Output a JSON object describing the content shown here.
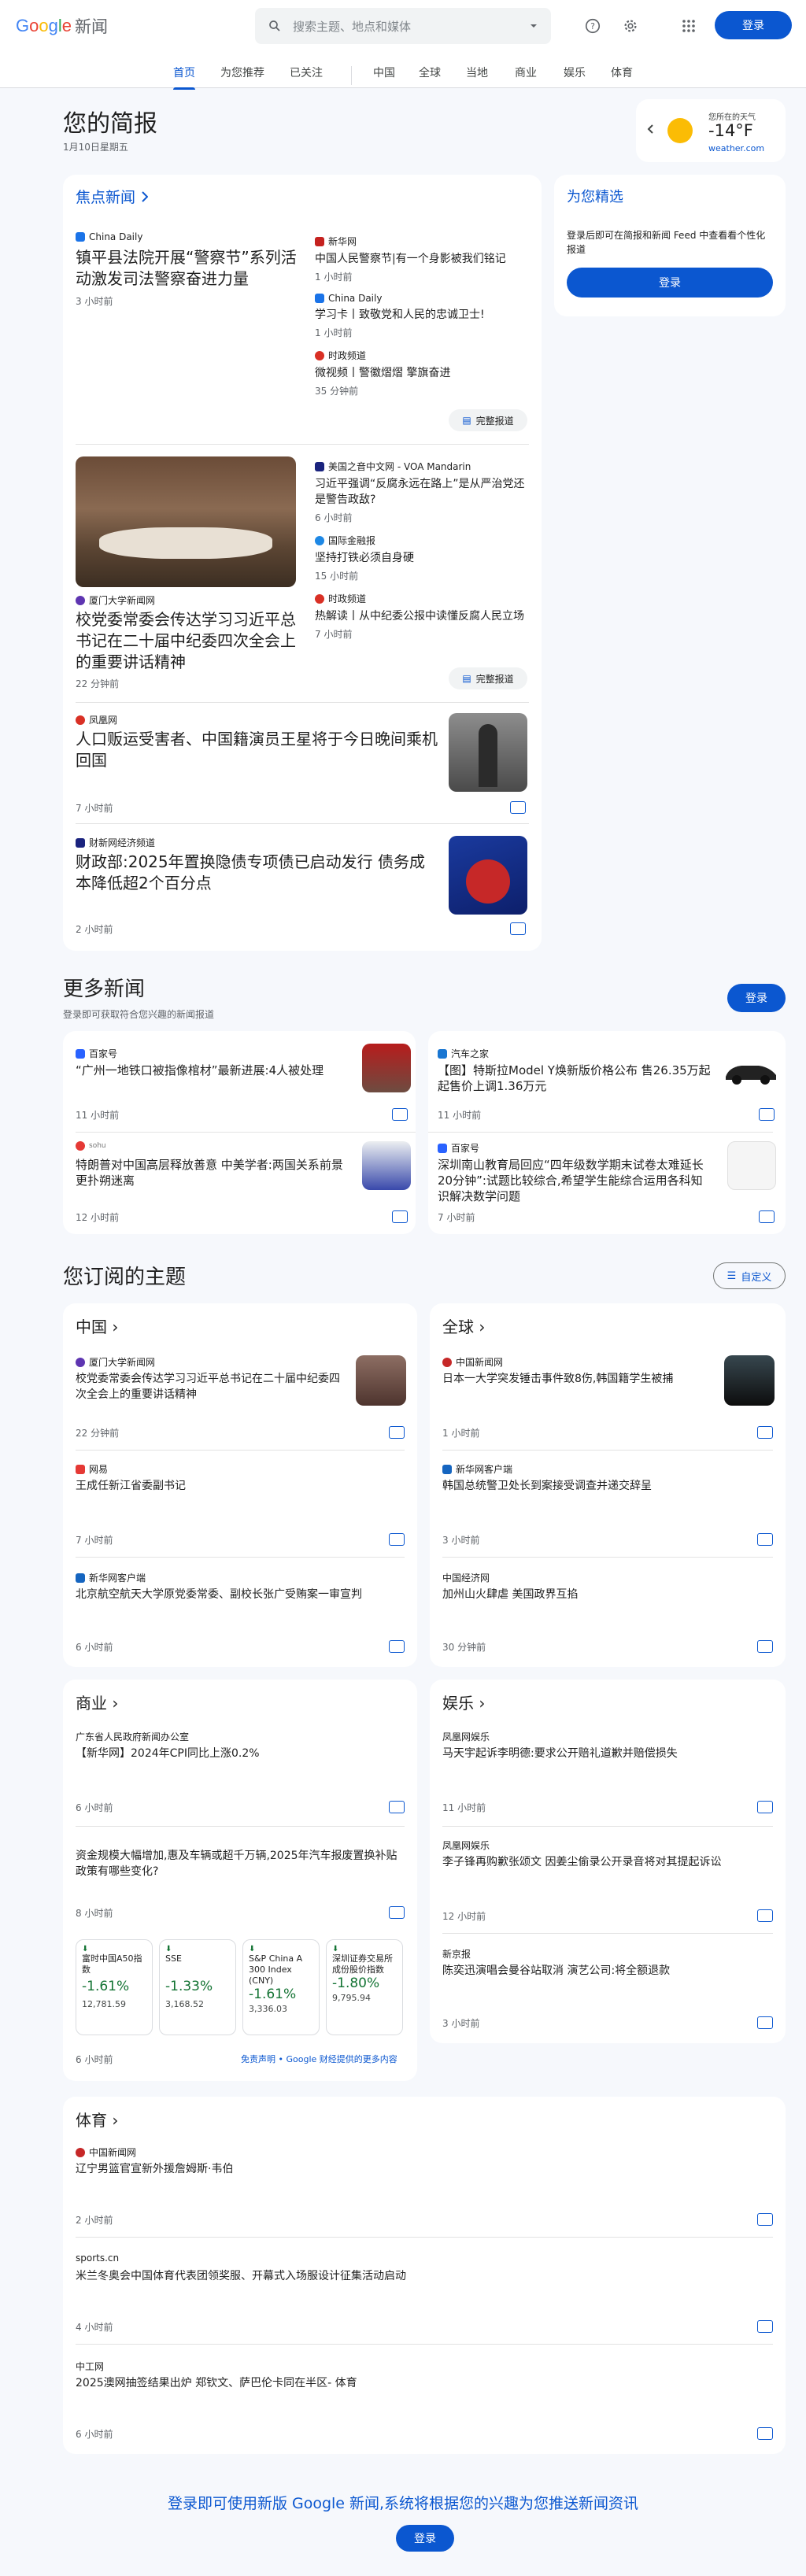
{
  "header": {
    "logo_google": "Google",
    "logo_news": "新闻",
    "search_placeholder": "搜索主题、地点和媒体",
    "signin": "登录"
  },
  "tabs": [
    "首页",
    "为您推荐",
    "已关注",
    "中国",
    "全球",
    "当地",
    "商业",
    "娱乐",
    "体育"
  ],
  "brief": {
    "title": "您的简报",
    "date": "1月10日星期五"
  },
  "weather": {
    "label": "您所在的天气",
    "temp": "-14°F",
    "source": "weather.com"
  },
  "picks": {
    "title": "为您精选",
    "desc": "登录后即可在简报和新闻 Feed 中查看看个性化报道",
    "button": "登录"
  },
  "top": {
    "title": "焦点新闻",
    "full_coverage": "完整报道",
    "s1": {
      "source": "China Daily",
      "headline": "镇平县法院开展“警察节”系列活动激发司法警察奋进力量",
      "time": "3 小时前",
      "side": [
        {
          "source": "新华网",
          "title": "中国人民警察节|有一个身影被我们铭记",
          "time": "1 小时前"
        },
        {
          "source": "China Daily",
          "title": "学习卡丨致敬党和人民的忠诚卫士!",
          "time": "1 小时前"
        },
        {
          "source": "时政频道",
          "title": "微视频丨警徽熠熠 擎旗奋进",
          "time": "35 分钟前"
        }
      ]
    },
    "s2": {
      "source": "厦门大学新闻网",
      "headline": "校党委常委会传达学习习近平总书记在二十届中纪委四次全会上的重要讲话精神",
      "time": "22 分钟前",
      "side": [
        {
          "source": "美国之音中文网 - VOA Mandarin",
          "title": "习近平强调“反腐永远在路上”是从严治党还是警告政敌?",
          "time": "6 小时前"
        },
        {
          "source": "国际金融报",
          "title": "坚持打铁必须自身硬",
          "time": "15 小时前"
        },
        {
          "source": "时政频道",
          "title": "热解读丨从中纪委公报中读懂反腐人民立场",
          "time": "7 小时前"
        }
      ]
    },
    "s3": {
      "source": "凤凰网",
      "headline": "人口贩运受害者、中国籍演员王星将于今日晚间乘机回国",
      "time": "7 小时前"
    },
    "s4": {
      "source": "财新网经济频道",
      "headline": "财政部:2025年置换隐债专项债已启动发行 债务成本降低超2个百分点",
      "time": "2 小时前"
    }
  },
  "more": {
    "title": "更多新闻",
    "desc": "登录即可获取符合您兴趣的新闻报道",
    "button": "登录",
    "items": [
      {
        "source": "百家号",
        "title": "“广州一地铁口被指像棺材”最新进展:4人被处理",
        "time": "11 小时前"
      },
      {
        "source": "汽车之家",
        "title": "【图】特斯拉Model Y焕新版价格公布 售26.35万起 起售价上调1.36万元",
        "time": "11 小时前"
      },
      {
        "source": "sohu",
        "title": "特朗普对中国高层释放善意 中美学者:两国关系前景更扑朔迷离",
        "time": "12 小时前"
      },
      {
        "source": "百家号",
        "title": "深圳南山教育局回应“四年级数学期末试卷太难延长20分钟”:试题比较综合,希望学生能综合运用各科知识解决数学问题",
        "time": "7 小时前"
      }
    ]
  },
  "topics": {
    "title": "您订阅的主题",
    "customize": "自定义",
    "china": {
      "title": "中国",
      "items": [
        {
          "source": "厦门大学新闻网",
          "title": "校党委常委会传达学习习近平总书记在二十届中纪委四次全会上的重要讲话精神",
          "time": "22 分钟前"
        },
        {
          "source": "网易",
          "title": "王成任新江省委副书记",
          "time": "7 小时前"
        },
        {
          "source": "新华网客户端",
          "title": "北京航空航天大学原党委常委、副校长张广受贿案一审宣判",
          "time": "6 小时前"
        }
      ]
    },
    "world": {
      "title": "全球",
      "items": [
        {
          "source": "中国新闻网",
          "title": "日本一大学突发锤击事件致8伤,韩国籍学生被捕",
          "time": "1 小时前"
        },
        {
          "source": "新华网客户端",
          "title": "韩国总统警卫处长到案接受调查并递交辞呈",
          "time": "3 小时前"
        },
        {
          "source": "中国经济网",
          "title": "加州山火肆虐 美国政界互掐",
          "time": "30 分钟前"
        }
      ]
    },
    "business": {
      "title": "商业",
      "items": [
        {
          "source": "广东省人民政府新闻办公室",
          "title": "【新华网】2024年CPI同比上涨0.2%",
          "time": "6 小时前"
        },
        {
          "source": "",
          "title": "资金规模大幅增加,惠及车辆或超千万辆,2025年汽车报废置换补贴政策有哪些变化?",
          "time": "8 小时前"
        }
      ],
      "stocks": [
        {
          "name": "富时中国A50指数",
          "pct": "-1.61%",
          "value": "12,781.59"
        },
        {
          "name": "SSE",
          "pct": "-1.33%",
          "value": "3,168.52"
        },
        {
          "name": "S&P China A 300 Index (CNY)",
          "pct": "-1.61%",
          "value": "3,336.03"
        },
        {
          "name": "深圳证券交易所成份股价指数",
          "pct": "-1.80%",
          "value": "9,795.94"
        }
      ],
      "footer_time": "6 小时前",
      "disclaimer": "免责声明 • Google 财经提供的更多内容"
    },
    "ent": {
      "title": "娱乐",
      "items": [
        {
          "source": "凤凰网娱乐",
          "title": "马天宇起诉李明德:要求公开赔礼道歉并赔偿损失",
          "time": "11 小时前"
        },
        {
          "source": "凤凰网娱乐",
          "title": "李子锋再购歉张颂文 因姜尘偷录公开录音将对其提起诉讼",
          "time": "12 小时前"
        },
        {
          "source": "新京报",
          "title": "陈奕迅演唱会曼谷站取消 演艺公司:将全额退款",
          "time": "3 小时前"
        }
      ]
    },
    "sports": {
      "title": "体育",
      "items": [
        {
          "source": "中国新闻网",
          "title": "辽宁男篮官宣新外援詹姆斯·韦伯",
          "time": "2 小时前"
        },
        {
          "source": "sports.cn",
          "title": "米兰冬奥会中国体育代表团领奖服、开幕式入场服设计征集活动启动",
          "time": "4 小时前"
        },
        {
          "source": "中工网",
          "title": "2025澳网抽签结果出炉 郑钦文、萨巴伦卡同在半区- 体育",
          "time": "6 小时前"
        }
      ]
    }
  },
  "footer": {
    "text": "登录即可使用新版 Google 新闻,系统将根据您的兴趣为您推送新闻资讯",
    "button": "登录"
  }
}
